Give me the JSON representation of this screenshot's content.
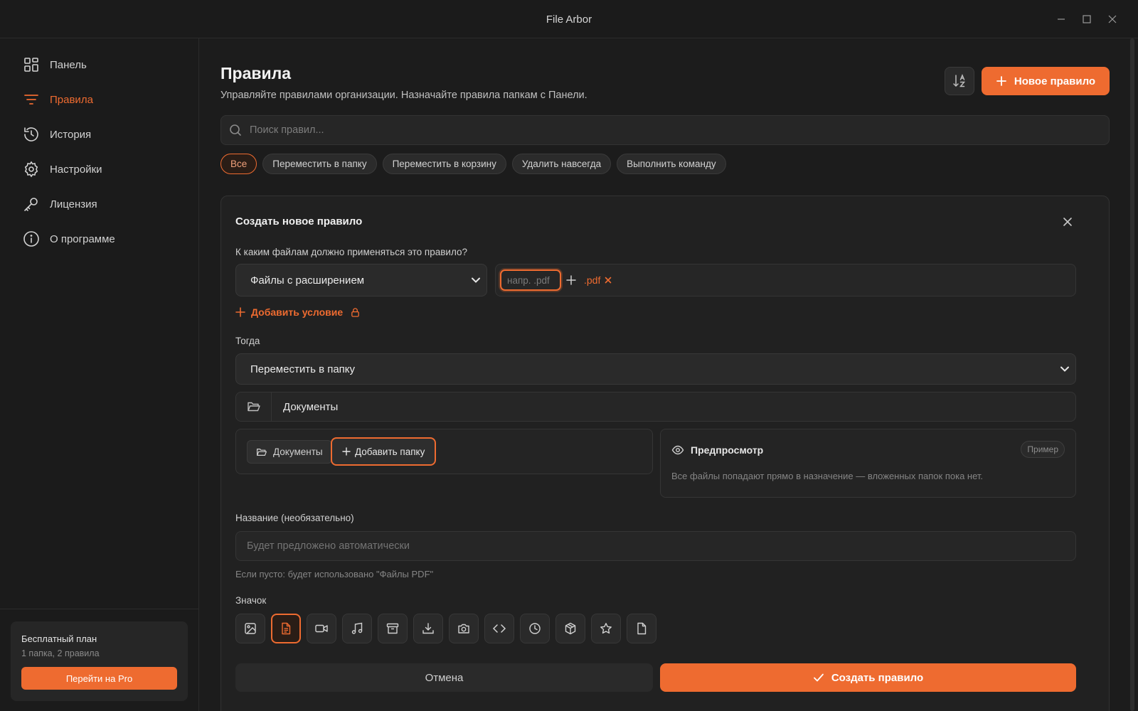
{
  "window": {
    "title": "File Arbor"
  },
  "sidebar": {
    "items": [
      {
        "label": "Панель",
        "icon": "dashboard-icon"
      },
      {
        "label": "Правила",
        "icon": "filter-lines-icon",
        "active": true
      },
      {
        "label": "История",
        "icon": "history-icon"
      },
      {
        "label": "Настройки",
        "icon": "gear-icon"
      },
      {
        "label": "Лицензия",
        "icon": "key-icon"
      },
      {
        "label": "О программе",
        "icon": "info-icon"
      }
    ],
    "plan": {
      "title": "Бесплатный план",
      "usage": "1 папка, 2 правила",
      "upgrade_label": "Перейти на Pro"
    }
  },
  "header": {
    "title": "Правила",
    "subtitle": "Управляйте правилами организации. Назначайте правила папкам с Панели.",
    "new_rule_label": "Новое правило"
  },
  "search": {
    "placeholder": "Поиск правил..."
  },
  "filters": [
    {
      "label": "Все",
      "active": true
    },
    {
      "label": "Переместить в папку"
    },
    {
      "label": "Переместить в корзину"
    },
    {
      "label": "Удалить навсегда"
    },
    {
      "label": "Выполнить команду"
    }
  ],
  "form": {
    "title": "Создать новое правило",
    "files_question": "К каким файлам должно применяться это правило?",
    "condition_type": "Файлы с расширением",
    "extension_placeholder": "напр. .pdf",
    "extensions": [
      ".pdf"
    ],
    "add_condition_label": "Добавить условие",
    "then_label": "Тогда",
    "action": "Переместить в папку",
    "destination_folder": "Документы",
    "folder_chips": [
      "Документы"
    ],
    "add_folder_label": "Добавить папку",
    "preview": {
      "title": "Предпросмотр",
      "badge": "Пример",
      "text": "Все файлы попадают прямо в назначение — вложенных папок пока нет."
    },
    "name_label": "Название (необязательно)",
    "name_placeholder": "Будет предложено автоматически",
    "name_hint": "Если пусто: будет использовано \"Файлы PDF\"",
    "icon_label": "Значок",
    "icons": [
      "image-icon",
      "document-icon",
      "video-icon",
      "music-icon",
      "archive-icon",
      "download-icon",
      "camera-icon",
      "code-icon",
      "clock-icon",
      "package-icon",
      "star-icon",
      "file-icon"
    ],
    "selected_icon": "document-icon",
    "cancel_label": "Отмена",
    "create_label": "Создать правило"
  },
  "colors": {
    "accent": "#ee6b30",
    "background": "#1c1c1c",
    "panel": "#212121"
  }
}
